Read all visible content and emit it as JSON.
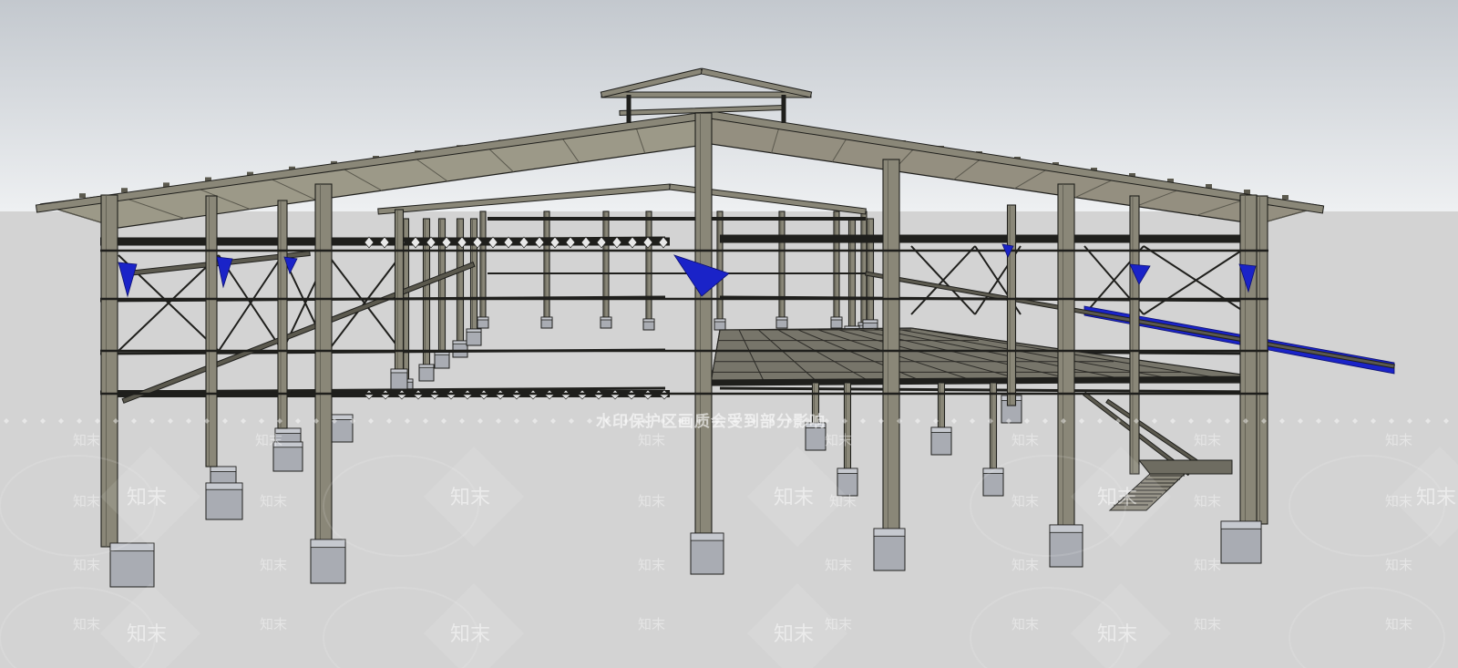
{
  "viewport": {
    "sky_top": "#c3c8ce",
    "sky_bottom": "#eef0f2",
    "ground": "#d3d3d3",
    "steel_face": "#8a8778",
    "steel_dark": "#5b594e",
    "steel_edge": "#1f1f1c",
    "brace_blue": "#1a23c8",
    "footing_face": "#a9acb3",
    "footing_top": "#c6c9cf"
  },
  "watermark": {
    "brand": "知末",
    "notice": "水印保护区画质会受到部分影响"
  }
}
